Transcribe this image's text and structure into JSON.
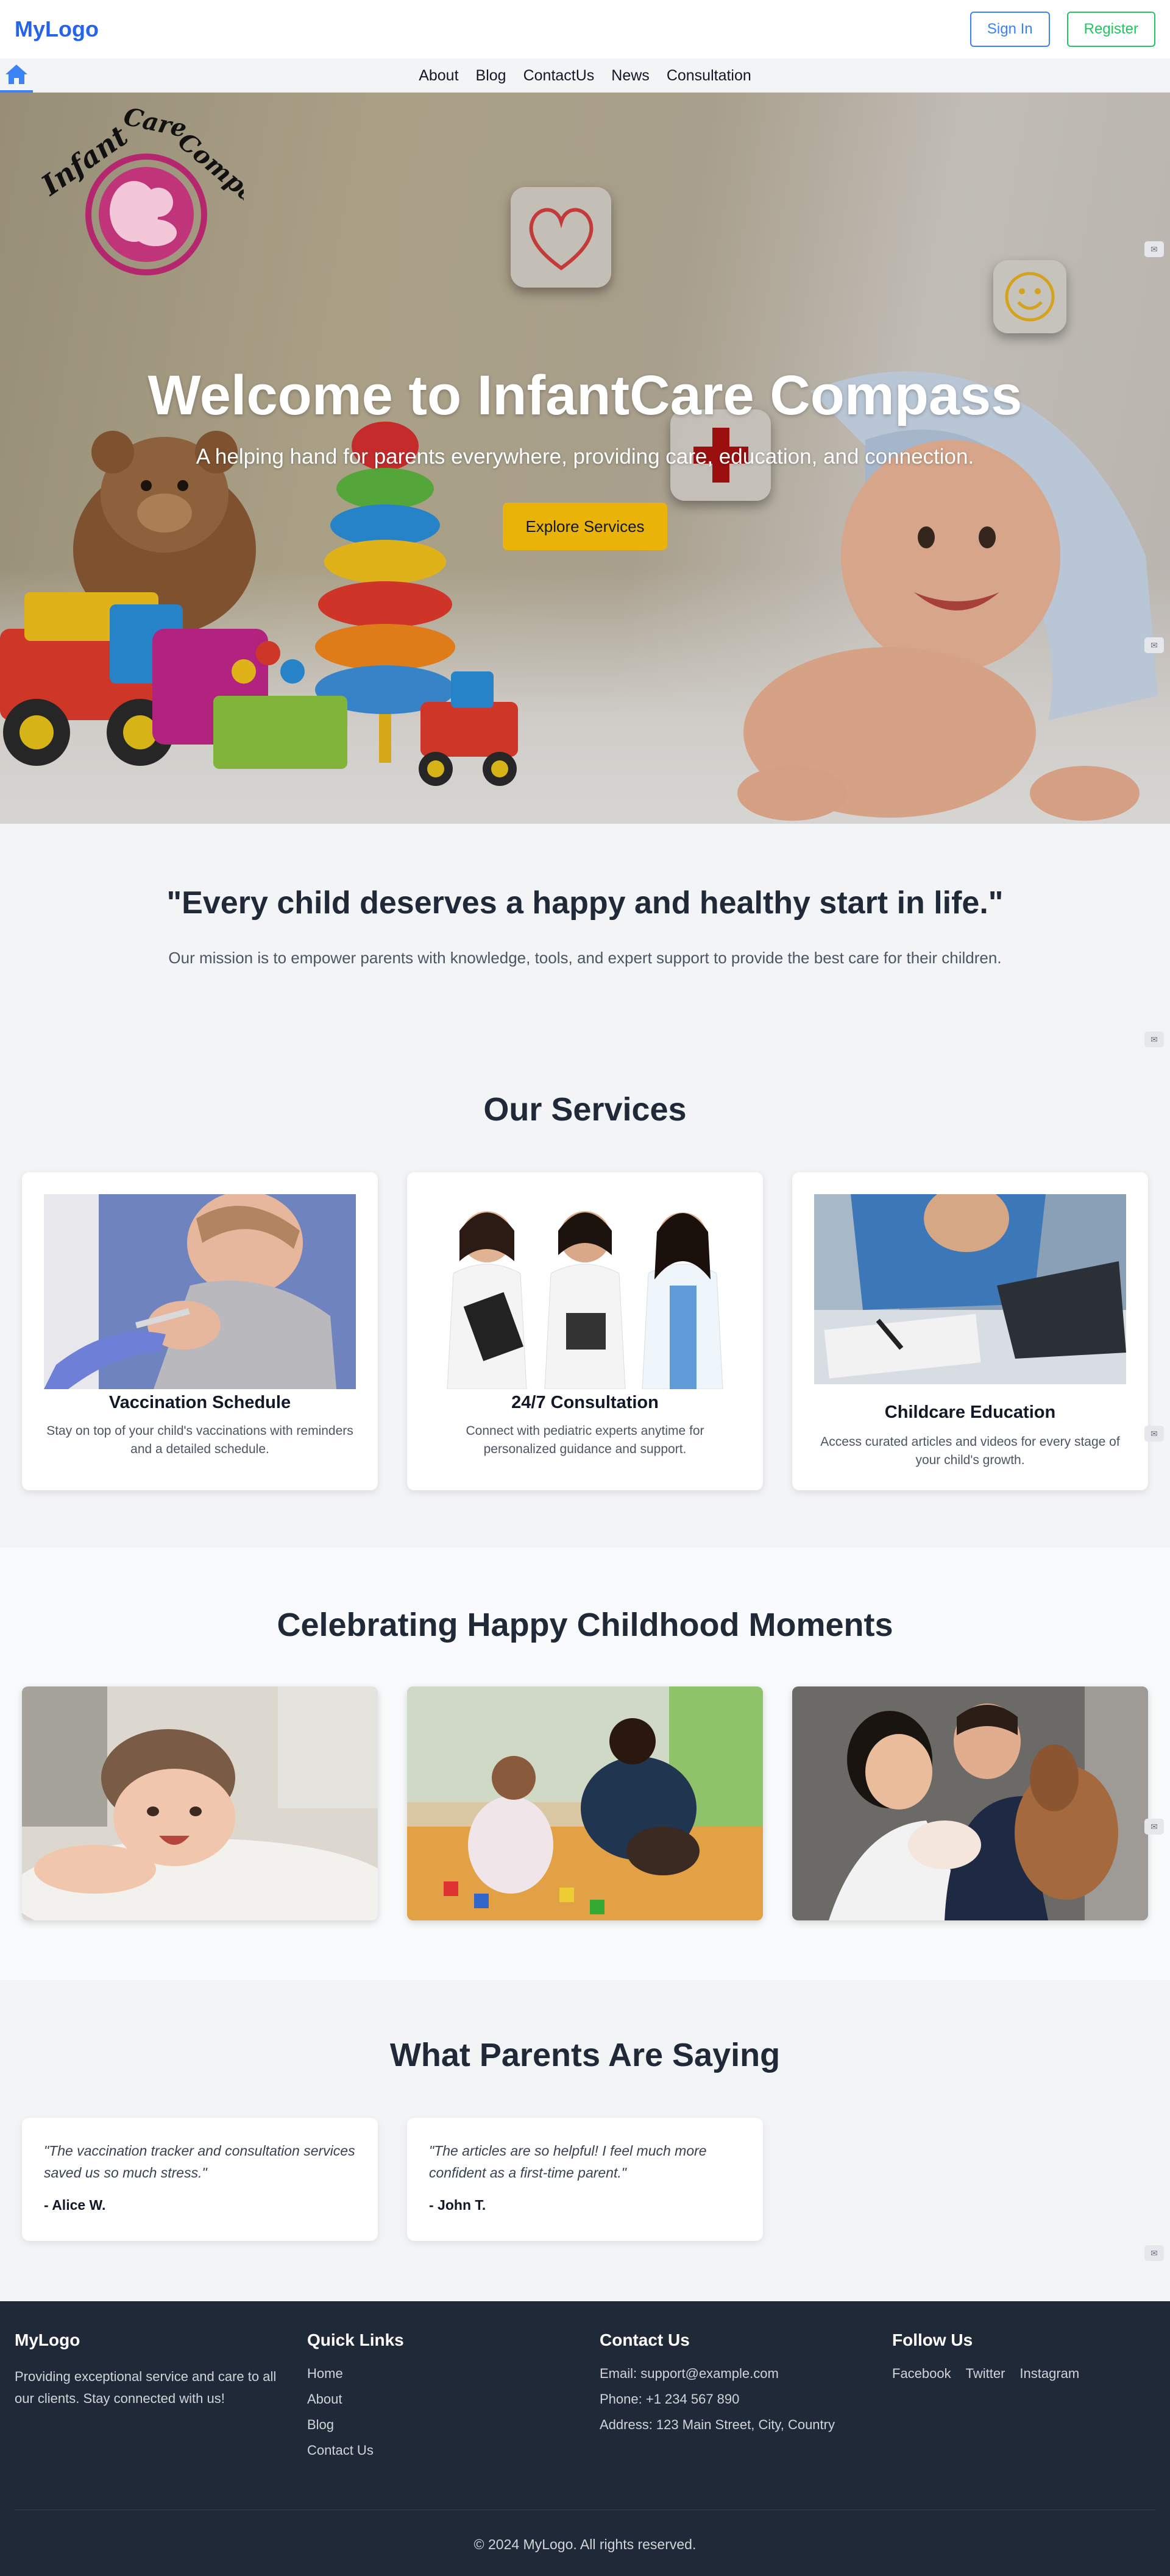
{
  "header": {
    "logo": "MyLogo",
    "sign_in": "Sign In",
    "register": "Register"
  },
  "nav": {
    "items": [
      "About",
      "Blog",
      "ContactUs",
      "News",
      "Consultation"
    ]
  },
  "hero": {
    "logo_text": "Infant Care Compass",
    "title": "Welcome to InfantCare Compass",
    "subtitle": "A helping hand for parents everywhere, providing care, education, and connection.",
    "cta": "Explore Services"
  },
  "mission": {
    "quote": "\"Every child deserves a happy and healthy start in life.\"",
    "text": "Our mission is to empower parents with knowledge, tools, and expert support to provide the best care for their children."
  },
  "services": {
    "title": "Our Services",
    "cards": [
      {
        "title": "Vaccination Schedule",
        "desc": "Stay on top of your child's vaccinations with reminders and a detailed schedule."
      },
      {
        "title": "24/7 Consultation",
        "desc": "Connect with pediatric experts anytime for personalized guidance and support."
      },
      {
        "title": "Childcare Education",
        "desc": "Access curated articles and videos for every stage of your child's growth."
      }
    ]
  },
  "moments": {
    "title": "Celebrating Happy Childhood Moments"
  },
  "testimonials": {
    "title": "What Parents Are Saying",
    "items": [
      {
        "quote": "\"The vaccination tracker and consultation services saved us so much stress.\"",
        "author": "- Alice W."
      },
      {
        "quote": "\"The articles are so helpful! I feel much more confident as a first-time parent.\"",
        "author": "- John T."
      }
    ]
  },
  "footer": {
    "brand": "MyLogo",
    "about": "Providing exceptional service and care to all our clients. Stay connected with us!",
    "quick_links_title": "Quick Links",
    "quick_links": [
      "Home",
      "About",
      "Blog",
      "Contact Us"
    ],
    "contact_title": "Contact Us",
    "email": "Email: support@example.com",
    "phone": "Phone: +1 234 567 890",
    "address": "Address: 123 Main Street, City, Country",
    "follow_title": "Follow Us",
    "social": [
      "Facebook",
      "Twitter",
      "Instagram"
    ],
    "copyright": "© 2024 MyLogo. All rights reserved."
  },
  "colors": {
    "primary": "#2563eb",
    "register": "#22c55e",
    "cta": "#eab308",
    "footer_bg": "#1f2937"
  }
}
